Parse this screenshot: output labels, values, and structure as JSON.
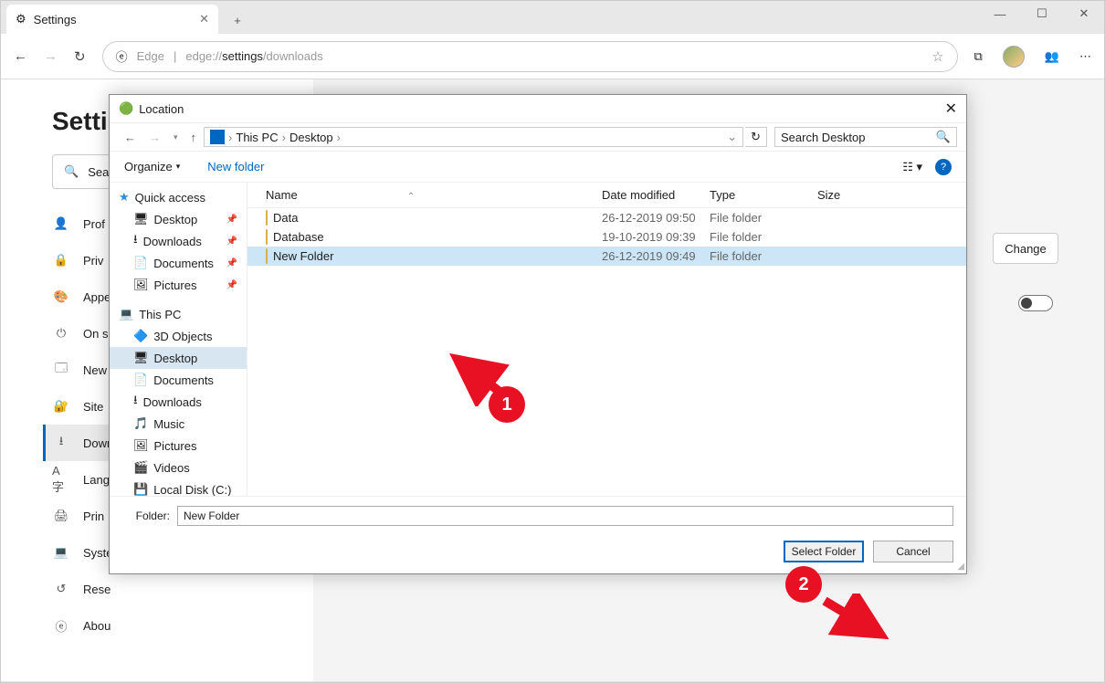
{
  "window": {
    "min": "—",
    "max": "☐",
    "close": "✕"
  },
  "tab": {
    "title": "Settings",
    "icon": "⚙"
  },
  "address": {
    "edge": "Edge",
    "url_prefix": "edge://",
    "url_mid": "settings",
    "url_suffix": "/downloads"
  },
  "settings": {
    "title": "Settings",
    "search_placeholder": "Search settings",
    "items": [
      {
        "icon": "👤",
        "label": "Profiles"
      },
      {
        "icon": "🔒",
        "label": "Privacy and services"
      },
      {
        "icon": "🎨",
        "label": "Appearance"
      },
      {
        "icon": "⏻",
        "label": "On startup"
      },
      {
        "icon": "🗔",
        "label": "New tab page"
      },
      {
        "icon": "🔐",
        "label": "Site permissions"
      },
      {
        "icon": "⭳",
        "label": "Downloads"
      },
      {
        "icon": "A字",
        "label": "Languages"
      },
      {
        "icon": "🖨",
        "label": "Printers"
      },
      {
        "icon": "💻",
        "label": "System"
      },
      {
        "icon": "↺",
        "label": "Reset settings"
      },
      {
        "icon": "ⓔ",
        "label": "About Microsoft Edge"
      }
    ],
    "change_btn": "Change"
  },
  "dialog": {
    "title": "Location",
    "breadcrumb": [
      "This PC",
      "Desktop"
    ],
    "search_placeholder": "Search Desktop",
    "organize": "Organize",
    "new_folder": "New folder",
    "columns": {
      "name": "Name",
      "date": "Date modified",
      "type": "Type",
      "size": "Size"
    },
    "rows": [
      {
        "name": "Data",
        "date": "26-12-2019 09:50",
        "type": "File folder"
      },
      {
        "name": "Database",
        "date": "19-10-2019 09:39",
        "type": "File folder"
      },
      {
        "name": "New Folder",
        "date": "26-12-2019 09:49",
        "type": "File folder",
        "selected": true
      }
    ],
    "tree": {
      "quick_access": "Quick access",
      "pins": [
        "Desktop",
        "Downloads",
        "Documents",
        "Pictures"
      ],
      "this_pc": "This PC",
      "pc_items": [
        "3D Objects",
        "Desktop",
        "Documents",
        "Downloads",
        "Music",
        "Pictures",
        "Videos",
        "Local Disk (C:)"
      ]
    },
    "folder_label": "Folder:",
    "folder_value": "New Folder",
    "select_btn": "Select Folder",
    "cancel_btn": "Cancel"
  },
  "annotations": {
    "one": "1",
    "two": "2"
  }
}
